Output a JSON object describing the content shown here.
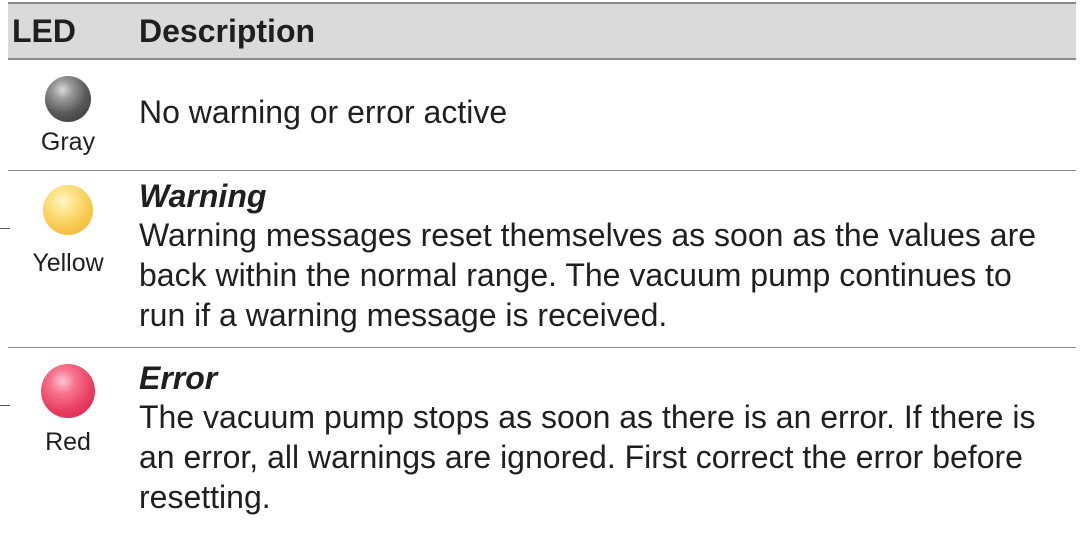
{
  "header": {
    "led": "LED",
    "description": "Description"
  },
  "rows": [
    {
      "led_label": "Gray",
      "led_color": "#5a5a5a",
      "title": "",
      "text": "No warning or error active"
    },
    {
      "led_label": "Yellow",
      "led_color": "#f9c94f",
      "title": "Warning",
      "text": "Warning messages reset themselves as soon as the values are back within the normal range. The vacuum pump continues to run if a warning message is received."
    },
    {
      "led_label": "Red",
      "led_color": "#ea3e63",
      "title": "Error",
      "text": "The vacuum pump stops as soon as there is an error. If there is an error, all warnings are ignored. First correct the error before resetting."
    }
  ]
}
